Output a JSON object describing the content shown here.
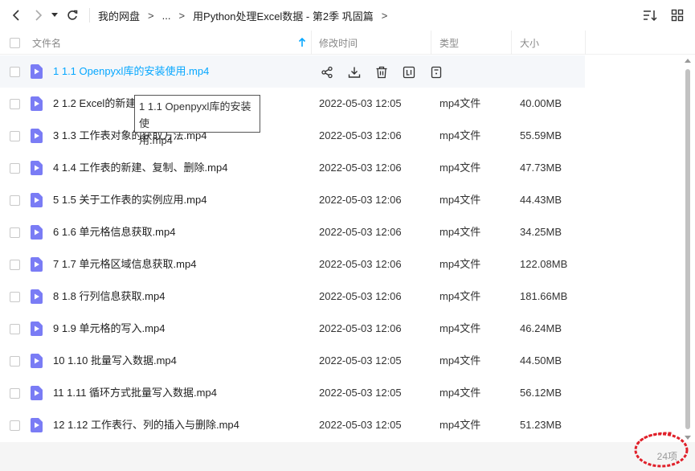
{
  "toolbar": {
    "breadcrumbs": {
      "root": "我的网盘",
      "ellipsis": "...",
      "current": "用Python处理Excel数据 - 第2季 巩固篇"
    },
    "separator": ">"
  },
  "columns": {
    "name": "文件名",
    "modified": "修改时间",
    "type": "类型",
    "size": "大小"
  },
  "files": [
    {
      "name": "1 1.1 Openpyxl库的安装使用.mp4",
      "modified": "",
      "type": "",
      "size": ""
    },
    {
      "name": "2 1.2 Excel的新建、",
      "modified": "2022-05-03 12:05",
      "type": "mp4文件",
      "size": "40.00MB"
    },
    {
      "name": "3 1.3 工作表对象的获取方法.mp4",
      "modified": "2022-05-03 12:06",
      "type": "mp4文件",
      "size": "55.59MB"
    },
    {
      "name": "4 1.4 工作表的新建、复制、删除.mp4",
      "modified": "2022-05-03 12:06",
      "type": "mp4文件",
      "size": "47.73MB"
    },
    {
      "name": "5 1.5 关于工作表的实例应用.mp4",
      "modified": "2022-05-03 12:06",
      "type": "mp4文件",
      "size": "44.43MB"
    },
    {
      "name": "6 1.6 单元格信息获取.mp4",
      "modified": "2022-05-03 12:06",
      "type": "mp4文件",
      "size": "34.25MB"
    },
    {
      "name": "7 1.7 单元格区域信息获取.mp4",
      "modified": "2022-05-03 12:06",
      "type": "mp4文件",
      "size": "122.08MB"
    },
    {
      "name": "8 1.8 行列信息获取.mp4",
      "modified": "2022-05-03 12:06",
      "type": "mp4文件",
      "size": "181.66MB"
    },
    {
      "name": "9 1.9 单元格的写入.mp4",
      "modified": "2022-05-03 12:06",
      "type": "mp4文件",
      "size": "46.24MB"
    },
    {
      "name": "10 1.10 批量写入数据.mp4",
      "modified": "2022-05-03 12:05",
      "type": "mp4文件",
      "size": "44.50MB"
    },
    {
      "name": "11 1.11 循环方式批量写入数据.mp4",
      "modified": "2022-05-03 12:05",
      "type": "mp4文件",
      "size": "56.12MB"
    },
    {
      "name": "12 1.12 工作表行、列的插入与删除.mp4",
      "modified": "2022-05-03 12:05",
      "type": "mp4文件",
      "size": "51.23MB"
    }
  ],
  "tooltip": {
    "line1": "1 1.1 Openpyxl库的安装使",
    "line2": "用.mp4"
  },
  "footer": {
    "count": "24项"
  },
  "colors": {
    "accent": "#06a7ff",
    "file_icon": "#7a7cf5",
    "annotation": "#e0202a"
  },
  "icons": {
    "actions": [
      "share-icon",
      "download-icon",
      "delete-icon",
      "rename-icon",
      "more-icon"
    ]
  }
}
